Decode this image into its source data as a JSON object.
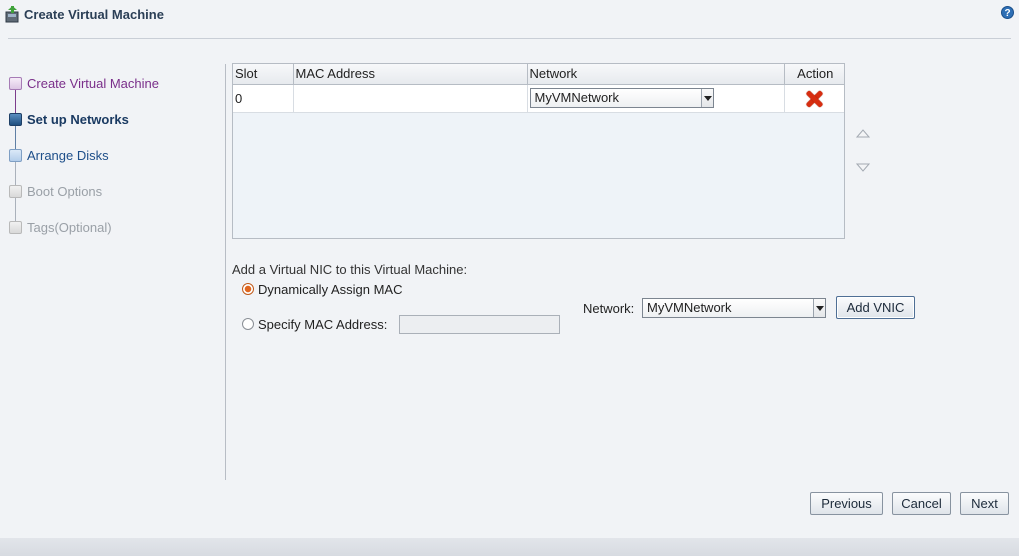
{
  "window": {
    "title": "Create Virtual Machine",
    "help_label": "?"
  },
  "train": {
    "steps": [
      {
        "label": "Create Virtual Machine",
        "state": "visited"
      },
      {
        "label": "Set up Networks",
        "state": "current"
      },
      {
        "label": "Arrange Disks",
        "state": "next"
      },
      {
        "label": "Boot Options",
        "state": "disabled"
      },
      {
        "label": "Tags(Optional)",
        "state": "disabled"
      }
    ]
  },
  "table": {
    "columns": [
      "Slot",
      "MAC Address",
      "Network",
      "Action"
    ],
    "rows": [
      {
        "slot": "0",
        "mac": "",
        "network": "MyVMNetwork"
      }
    ]
  },
  "add_vnic": {
    "section_label": "Add a Virtual NIC to this Virtual Machine:",
    "option_dynamic": "Dynamically Assign MAC",
    "option_specify": "Specify MAC Address:",
    "selected_option": "dynamic",
    "mac_value": "",
    "network_label": "Network:",
    "network_value": "MyVMNetwork",
    "add_button": "Add VNIC"
  },
  "footer": {
    "previous": "Previous",
    "cancel": "Cancel",
    "next": "Next"
  },
  "colors": {
    "accent": "#2b3f56",
    "delete": "#d72d10",
    "radio_selected": "#e0661f"
  }
}
